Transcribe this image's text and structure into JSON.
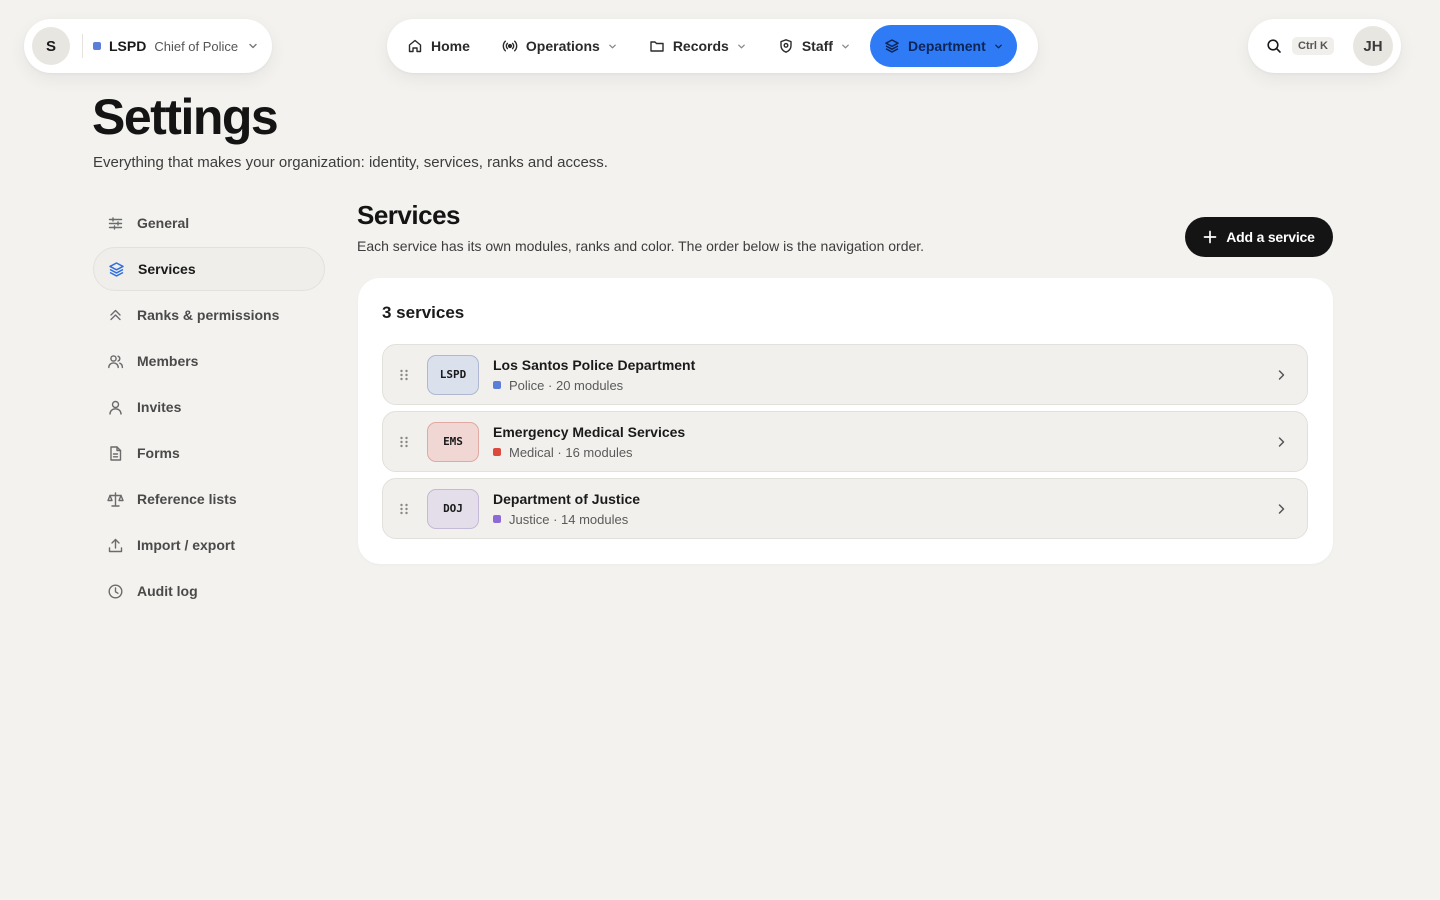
{
  "org": {
    "avatar": "S",
    "code": "LSPD",
    "role": "Chief of Police",
    "dot_color": "#5b7fd9"
  },
  "nav": {
    "items": [
      {
        "label": "Home",
        "icon": "home-icon"
      },
      {
        "label": "Operations",
        "icon": "broadcast-icon"
      },
      {
        "label": "Records",
        "icon": "folder-icon"
      },
      {
        "label": "Staff",
        "icon": "shield-icon"
      },
      {
        "label": "Department",
        "icon": "layers-icon",
        "active": true
      }
    ],
    "active_color": "#2f7bf5"
  },
  "utility": {
    "shortcut": "Ctrl K",
    "user_initials": "JH"
  },
  "page": {
    "title": "Settings",
    "subtitle": "Everything that makes your organization: identity, services, ranks and access."
  },
  "sidebar": {
    "items": [
      {
        "label": "General",
        "icon": "sliders-icon"
      },
      {
        "label": "Services",
        "icon": "layers-icon",
        "active": true
      },
      {
        "label": "Ranks & permissions",
        "icon": "chevrons-up-icon"
      },
      {
        "label": "Members",
        "icon": "users-icon"
      },
      {
        "label": "Invites",
        "icon": "user-icon"
      },
      {
        "label": "Forms",
        "icon": "file-icon"
      },
      {
        "label": "Reference lists",
        "icon": "scale-icon"
      },
      {
        "label": "Import / export",
        "icon": "upload-icon"
      },
      {
        "label": "Audit log",
        "icon": "clock-icon"
      }
    ]
  },
  "main": {
    "title": "Services",
    "subtitle": "Each service has its own modules, ranks and color. The order below is the navigation order.",
    "add_button": "Add a service",
    "count_label": "3 services",
    "services": [
      {
        "badge": "LSPD",
        "name": "Los Santos Police Department",
        "meta": "Police · 20 modules",
        "badge_bg": "#dbe0ed",
        "badge_border": "#aeb8d2",
        "dot_color": "#5b7fd9"
      },
      {
        "badge": "EMS",
        "name": "Emergency Medical Services",
        "meta": "Medical · 16 modules",
        "badge_bg": "#f1d7d3",
        "badge_border": "#e0a9a1",
        "dot_color": "#dc4a3d"
      },
      {
        "badge": "DOJ",
        "name": "Department of Justice",
        "meta": "Justice · 14 modules",
        "badge_bg": "#e3deea",
        "badge_border": "#c4b9d6",
        "dot_color": "#8d6bd6"
      }
    ]
  }
}
